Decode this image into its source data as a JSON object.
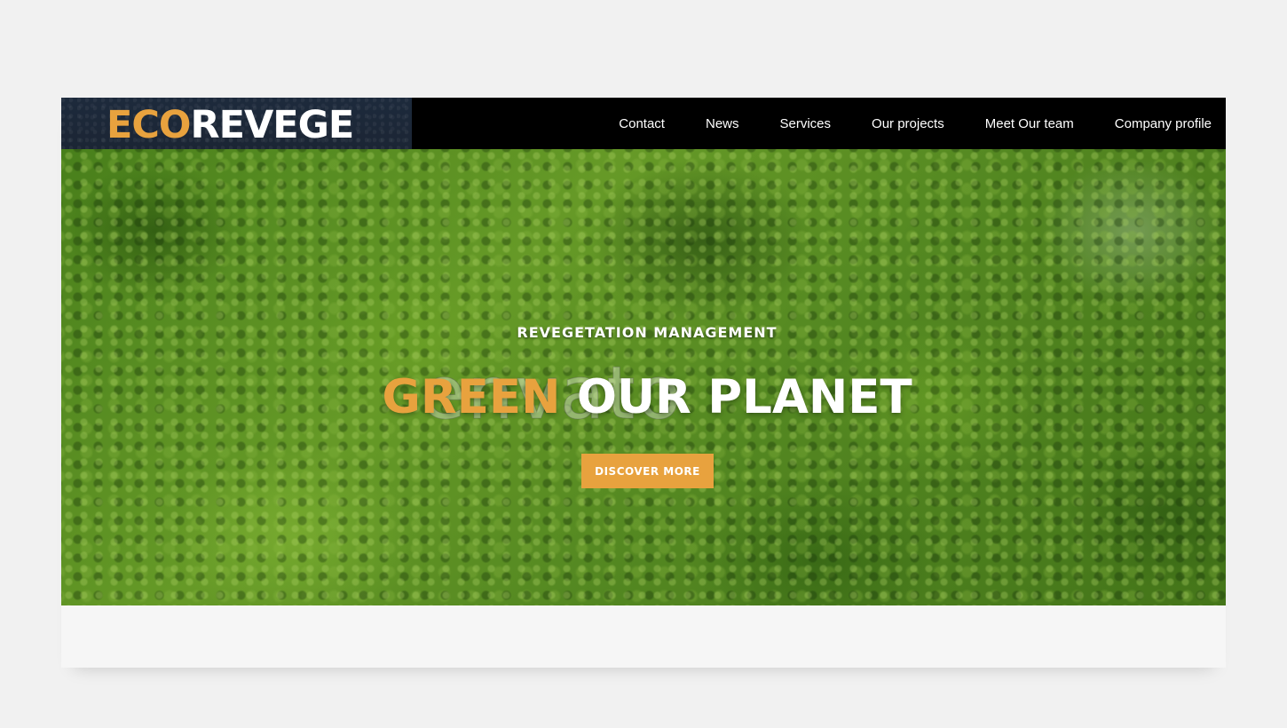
{
  "brand": {
    "logo_part1": "ECO",
    "logo_part2": "REVEGE",
    "accent_color": "#e8a23e"
  },
  "nav": {
    "items": [
      {
        "label": "Contact"
      },
      {
        "label": "News"
      },
      {
        "label": "Services"
      },
      {
        "label": "Our projects"
      },
      {
        "label": "Meet Our team"
      },
      {
        "label": "Company profile"
      }
    ]
  },
  "hero": {
    "kicker": "REVEGETATION MANAGEMENT",
    "headline_accent": "GREEN",
    "headline_rest": " OUR PLANET",
    "watermark": "envato",
    "cta_label": "DISCOVER MORE"
  }
}
